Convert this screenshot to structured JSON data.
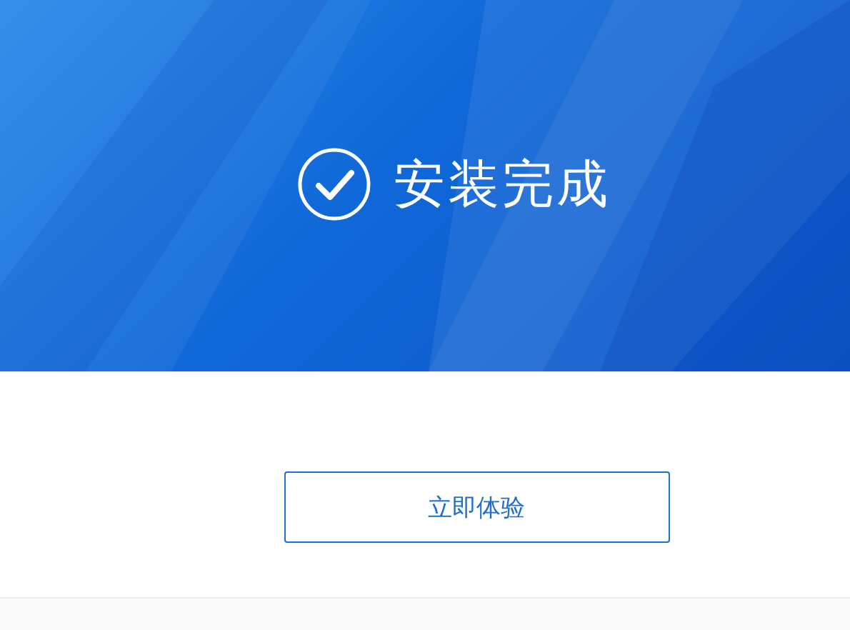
{
  "banner": {
    "title": "安装完成"
  },
  "action_button": {
    "label": "立即体验"
  }
}
